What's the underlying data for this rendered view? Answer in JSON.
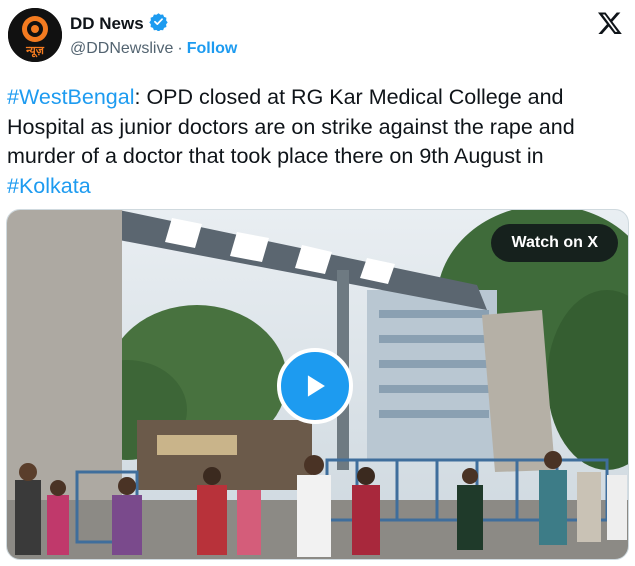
{
  "author": {
    "display_name": "DD News",
    "handle": "@DDNewslive",
    "separator": "·",
    "follow_label": "Follow",
    "verified_color": "#1d9bf0",
    "avatar_icon": "dd-news-logo",
    "avatar_text": "न्यूज़"
  },
  "platform_icon": "x-logo-icon",
  "tweet": {
    "segments": [
      {
        "type": "hashtag",
        "text": "#WestBengal"
      },
      {
        "type": "text",
        "text": ": OPD closed at RG Kar Medical College and Hospital as junior doctors are on strike against the rape and murder of a doctor that took place there on 9th August in "
      },
      {
        "type": "hashtag",
        "text": "#Kolkata"
      }
    ]
  },
  "media": {
    "watch_label": "Watch on X",
    "play_icon": "play-icon",
    "accent_color": "#1d9bf0"
  }
}
